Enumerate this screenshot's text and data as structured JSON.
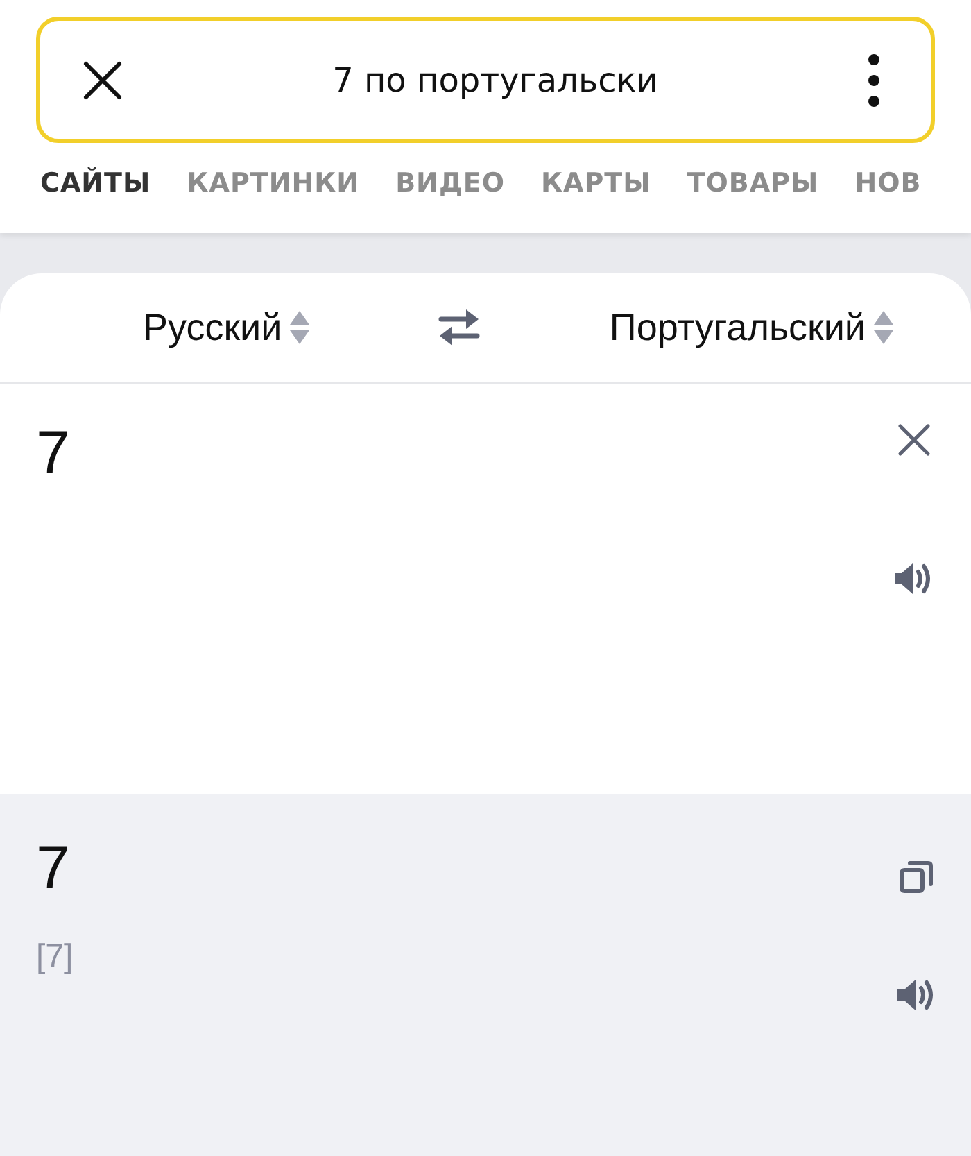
{
  "search": {
    "value": "7 по португальски"
  },
  "tabs": [
    {
      "label": "САЙТЫ",
      "selected": true
    },
    {
      "label": "КАРТИНКИ",
      "selected": false
    },
    {
      "label": "ВИДЕО",
      "selected": false
    },
    {
      "label": "КАРТЫ",
      "selected": false
    },
    {
      "label": "ТОВАРЫ",
      "selected": false
    },
    {
      "label": "НОВ",
      "selected": false
    }
  ],
  "translator": {
    "source_language": "Русский",
    "target_language": "Португальский",
    "source_text": "7",
    "translation": "7",
    "transcription": "[7]"
  }
}
